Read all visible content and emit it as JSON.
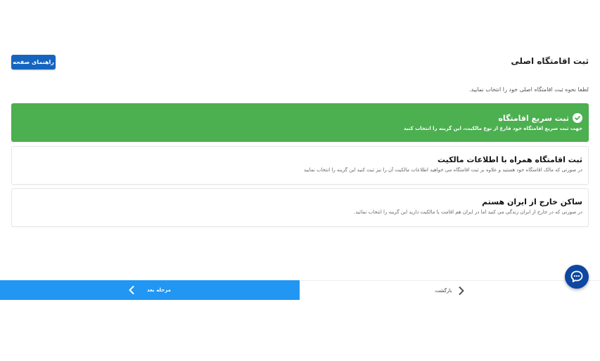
{
  "header": {
    "title": "ثبت اقامتگاه اصلی",
    "help_button": "راهنمای صفحه"
  },
  "instruction": "لطفا نحوه ثبت اقامتگاه اصلی خود را انتخاب نمایید.",
  "options": [
    {
      "title": "ثبت سریع اقامتگاه",
      "description": "جهت ثبت سریع اقامتگاه خود فارغ از نوع مالکیت، این گزینه را انتخاب کنید",
      "selected": true
    },
    {
      "title": "ثبت اقامتگاه همراه با اطلاعات مالکیت",
      "description": "در صورتی که مالک اقامتگاه خود هستید و علاوه بر ثبت اقامتگاه می خواهید اطلاعات مالکیت آن را نیز ثبت کنید این گزینه را انتخاب نمایید",
      "selected": false
    },
    {
      "title": "ساکن خارج از ایران هستم",
      "description": "در صورتی که در خارج از ایران زندگی می کنید اما در ایران هم اقامت یا مالکیت دارید این گزینه را انتخاب نمائید.",
      "selected": false
    }
  ],
  "footer": {
    "next_label": "مرحله بعد",
    "back_label": "بازگشت"
  },
  "icons": {
    "check": "check-circle-icon",
    "next": "chevron-left-icon",
    "back": "chevron-right-icon",
    "chat": "chat-bubble-icon"
  },
  "colors": {
    "selected_green": "#4caf50",
    "primary_blue": "#2196f3",
    "help_blue": "#1565c0",
    "chat_navy": "#0d47a1"
  }
}
